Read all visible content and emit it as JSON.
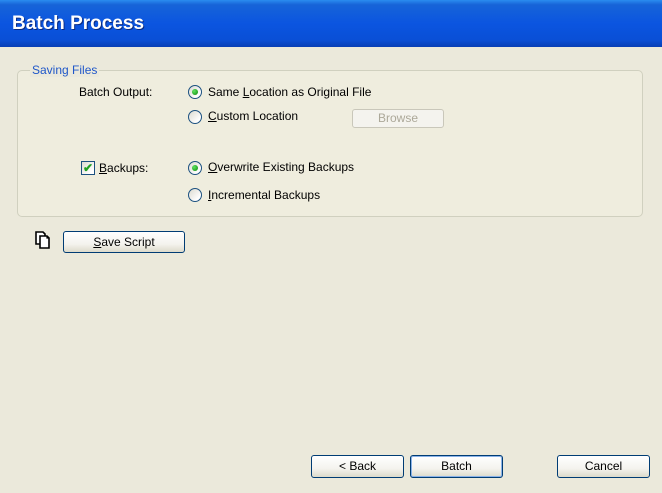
{
  "title": "Batch Process",
  "group": {
    "legend": "Saving Files",
    "batch_output_label": "Batch Output:",
    "same_location": {
      "prefix": "Same ",
      "accel": "L",
      "suffix": "ocation as Original File",
      "checked": true
    },
    "custom_location": {
      "prefix": "",
      "accel": "C",
      "suffix": "ustom Location",
      "checked": false
    },
    "browse_label": "Browse",
    "backups": {
      "prefix": "",
      "accel": "B",
      "suffix": "ackups:",
      "checked": true
    },
    "overwrite": {
      "prefix": "",
      "accel": "O",
      "suffix": "verwrite Existing Backups",
      "checked": true
    },
    "incremental": {
      "prefix": "",
      "accel": "I",
      "suffix": "ncremental Backups",
      "checked": false
    }
  },
  "script": {
    "icon": "copy-document-icon",
    "save_prefix": "",
    "save_accel": "S",
    "save_suffix": "ave Script"
  },
  "footer": {
    "back_label": "< Back",
    "batch_label": "Batch",
    "cancel_label": "Cancel"
  },
  "colors": {
    "title_bar": "#0b55e0",
    "legend_text": "#1f57c9",
    "check_green": "#21a121"
  }
}
